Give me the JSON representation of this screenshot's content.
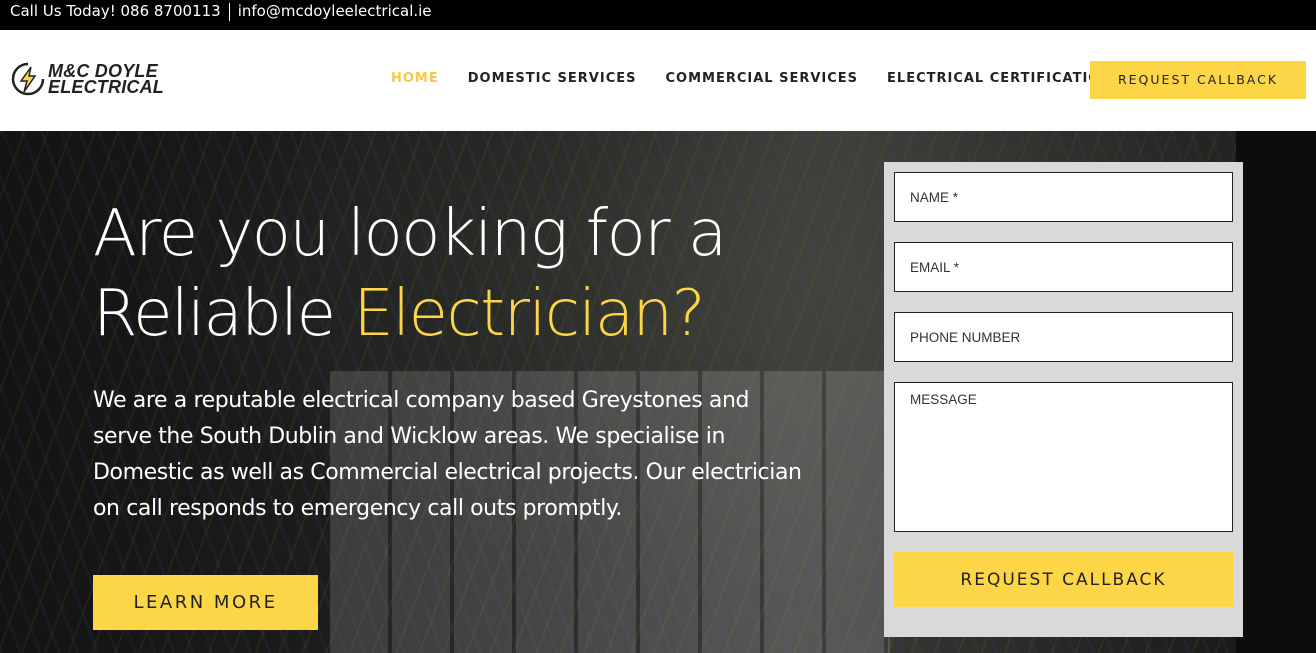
{
  "topbar": {
    "call": "Call Us Today! 086 8700113",
    "email": "info@mcdoyleelectrical.ie"
  },
  "logo": {
    "line1": "M&C DOYLE",
    "line2": "ELECTRICAL",
    "icon": "lightning-bolt-icon"
  },
  "nav": {
    "home": "HOME",
    "domestic": "DOMESTIC SERVICES",
    "commercial": "COMMERCIAL SERVICES",
    "certification": "ELECTRICAL CERTIFICATION",
    "cta": "REQUEST CALLBACK"
  },
  "hero": {
    "title_line1": "Are you looking for a",
    "title_line2_plain": "Reliable ",
    "title_line2_accent": "Electrician?",
    "body": "We are a reputable electrical company based Greystones and serve the South Dublin and Wicklow areas. We specialise in Domestic as well as Commercial electrical projects. Our electrician on call responds to emergency call outs promptly.",
    "button": "LEARN MORE"
  },
  "form": {
    "name_placeholder": "NAME *",
    "email_placeholder": "EMAIL *",
    "phone_placeholder": "PHONE NUMBER",
    "message_placeholder": "MESSAGE",
    "submit": "REQUEST CALLBACK"
  },
  "colors": {
    "accent": "#fdd648",
    "dark": "#000000",
    "text": "#222222"
  }
}
